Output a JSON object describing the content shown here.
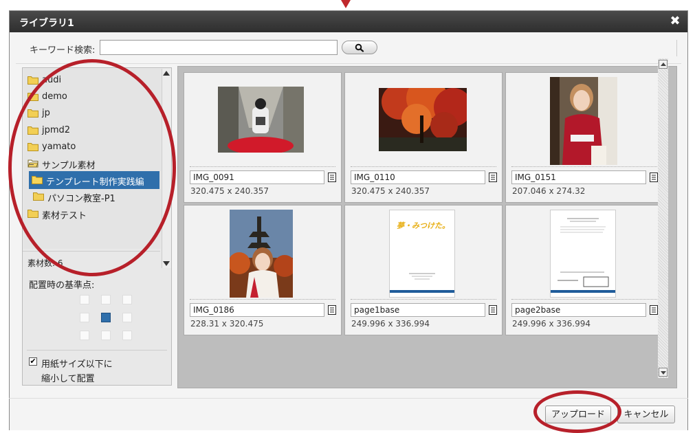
{
  "dialog": {
    "title": "ライブラリ1",
    "close_glyph": "✖"
  },
  "search": {
    "label": "キーワード検索:",
    "value": "",
    "placeholder": ""
  },
  "folders": [
    {
      "label": "audi",
      "state": "closed"
    },
    {
      "label": "demo",
      "state": "closed"
    },
    {
      "label": "jp",
      "state": "closed"
    },
    {
      "label": "jpmd2",
      "state": "closed"
    },
    {
      "label": "yamato",
      "state": "closed"
    },
    {
      "label": "サンプル素材",
      "state": "open"
    },
    {
      "label": "テンプレート制作実践編",
      "state": "selected"
    },
    {
      "label": "パソコン教室-P1",
      "state": "closed"
    },
    {
      "label": "素材テスト",
      "state": "closed"
    }
  ],
  "material_count": "素材数: 6",
  "anchor": {
    "label": "配置時の基準点:",
    "selected_row": 1,
    "selected_col": 1
  },
  "shrink": {
    "checked": true,
    "check_glyph": "✔",
    "line1": "用紙サイズ以下に",
    "line2": "縮小して配置"
  },
  "items": [
    {
      "name": "IMG_0091",
      "dims": "320.475 x 240.357",
      "icon": "document-icon"
    },
    {
      "name": "IMG_0110",
      "dims": "320.475 x 240.357",
      "icon": "document-icon"
    },
    {
      "name": "IMG_0151",
      "dims": "207.046 x 274.32",
      "icon": "document-icon"
    },
    {
      "name": "IMG_0186",
      "dims": "228.31 x 320.475",
      "icon": "document-icon"
    },
    {
      "name": "page1base",
      "dims": "249.996 x 336.994",
      "icon": "document-icon",
      "thumb_text": "夢・みつけた。"
    },
    {
      "name": "page2base",
      "dims": "249.996 x 336.994",
      "icon": "document-icon"
    }
  ],
  "buttons": {
    "upload": "アップロード",
    "cancel": "キャンセル"
  },
  "colors": {
    "highlight_red": "#b7202a",
    "selected_blue": "#2f6fab",
    "titlebar": "#333333"
  }
}
